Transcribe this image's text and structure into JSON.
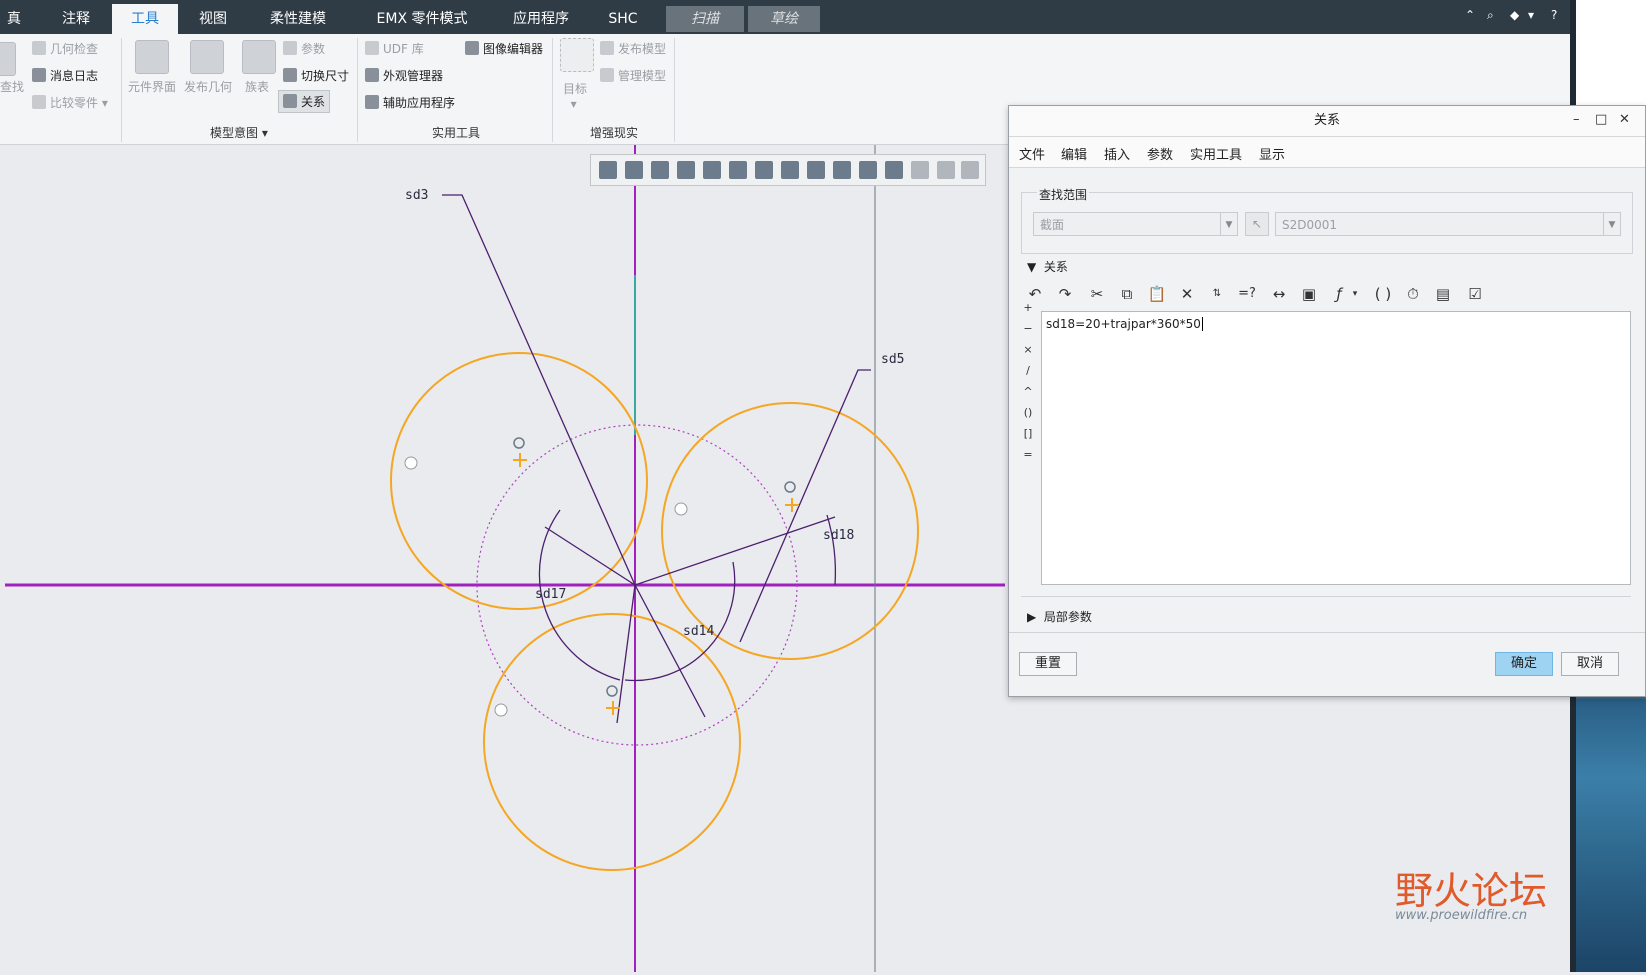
{
  "tabs": [
    {
      "label": "仿真",
      "shown": "真"
    },
    {
      "label": "注释"
    },
    {
      "label": "工具"
    },
    {
      "label": "视图"
    },
    {
      "label": "柔性建模"
    },
    {
      "label": "EMX 零件模式"
    },
    {
      "label": "应用程序"
    },
    {
      "label": "SHC"
    },
    {
      "label": "扫描"
    },
    {
      "label": "草绘"
    }
  ],
  "ribbon": {
    "investigate": {
      "find": "查找",
      "geometry_check": "几何检查",
      "message_log": "消息日志",
      "compare_part": "比较零件"
    },
    "model_intent": {
      "component_interface": "元件界面",
      "publish_geometry": "发布几何",
      "family_table": "族表",
      "parameters": "参数",
      "switch_dimensions": "切换尺寸",
      "relations": "关系",
      "group_label": "模型意图"
    },
    "utilities": {
      "udf_library": "UDF 库",
      "image_editor": "图像编辑器",
      "appearance_manager": "外观管理器",
      "auxiliary_apps": "辅助应用程序",
      "group_label": "实用工具"
    },
    "ar": {
      "target": "目标",
      "publish_model": "发布模型",
      "manage_model": "管理模型",
      "group_label": "增强现实"
    }
  },
  "sketch_labels": {
    "sd3": "sd3",
    "sd5": "sd5",
    "sd18": "sd18",
    "sd17": "sd17",
    "sd14": "sd14"
  },
  "dialog": {
    "title": "关系",
    "menu": [
      "文件",
      "编辑",
      "插入",
      "参数",
      "实用工具",
      "显示"
    ],
    "lookup_scope_label": "查找范围",
    "scope_type": "截面",
    "scope_value": "S2D0001",
    "relations_section": "关系",
    "relation_text": "sd18=20+trajpar*360*50",
    "operators": [
      "+",
      "−",
      "×",
      "/",
      "^",
      "()",
      "[]",
      "="
    ],
    "local_params": "局部参数",
    "reset": "重置",
    "ok": "确定",
    "cancel": "取消"
  },
  "watermark": {
    "name": "野火论坛",
    "url": "www.proewildfire.cn"
  },
  "colors": {
    "tabbar": "#2f3b45",
    "active_tab_text": "#2a7fd0",
    "circle": "#f5a623",
    "dimension": "#4b1f6e",
    "centerline": "#a020c0",
    "ok_button": "#9fd3f2"
  }
}
